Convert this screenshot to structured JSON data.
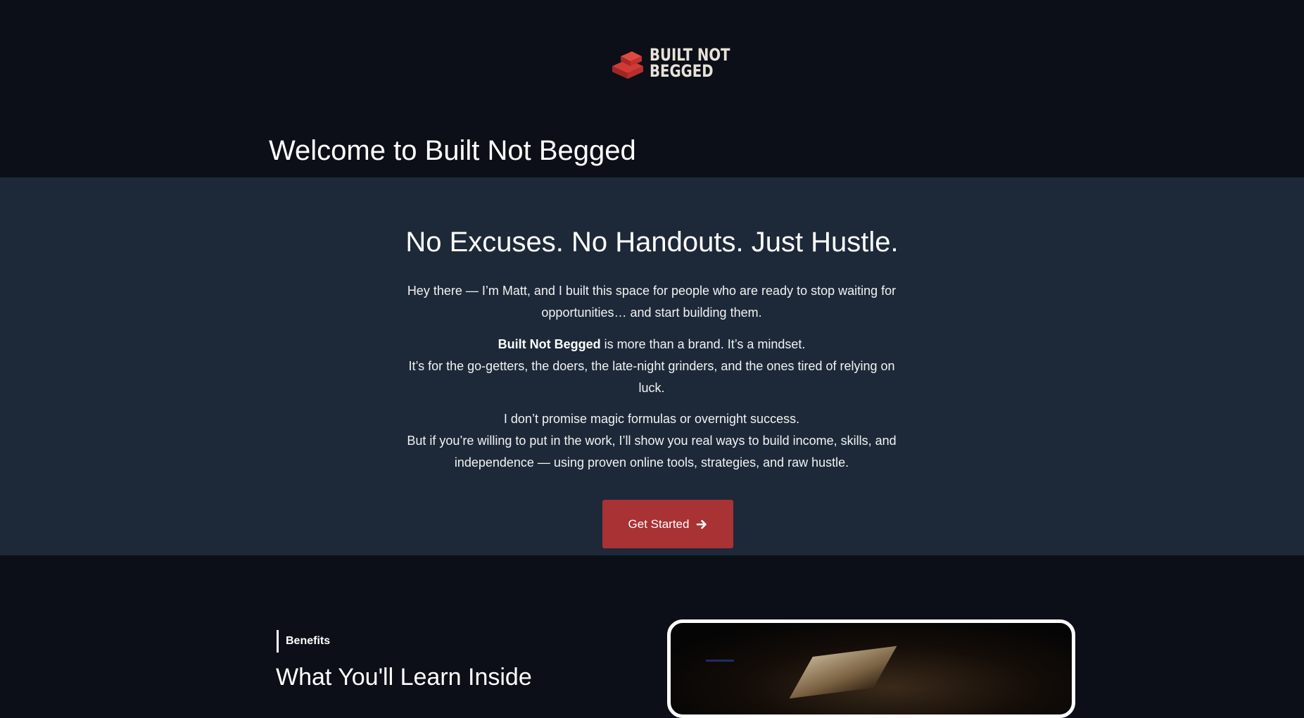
{
  "brand": {
    "logo_line1": "BUILT NOT",
    "logo_line2": "BEGGED",
    "logo_color": "#c0302e"
  },
  "header": {
    "welcome_title": "Welcome to Built Not Begged"
  },
  "hero": {
    "headline": "No Excuses. No Handouts. Just Hustle.",
    "para1": "Hey there — I’m Matt, and I built this space for people who are ready to stop waiting for opportunities… and start building them.",
    "para2_bold": "Built Not Begged",
    "para2_rest": " is more than a brand. It’s a mindset.",
    "para2_line2": "It’s for the go-getters, the doers, the late-night grinders, and the ones tired of relying on luck.",
    "para3_line1": "I don’t promise magic formulas or overnight success.",
    "para3_line2": "But if you’re willing to put in the work, I’ll show you real ways to build income, skills, and independence — using proven online tools, strategies, and raw hustle.",
    "cta_label": "Get Started",
    "cta_icon": "arrow-right-icon",
    "cta_color": "#a93234",
    "background": "#1d2939"
  },
  "benefits": {
    "eyebrow": "Benefits",
    "title": "What You'll Learn Inside"
  },
  "colors": {
    "page_background": "#0c0f17",
    "text": "#ffffff"
  }
}
